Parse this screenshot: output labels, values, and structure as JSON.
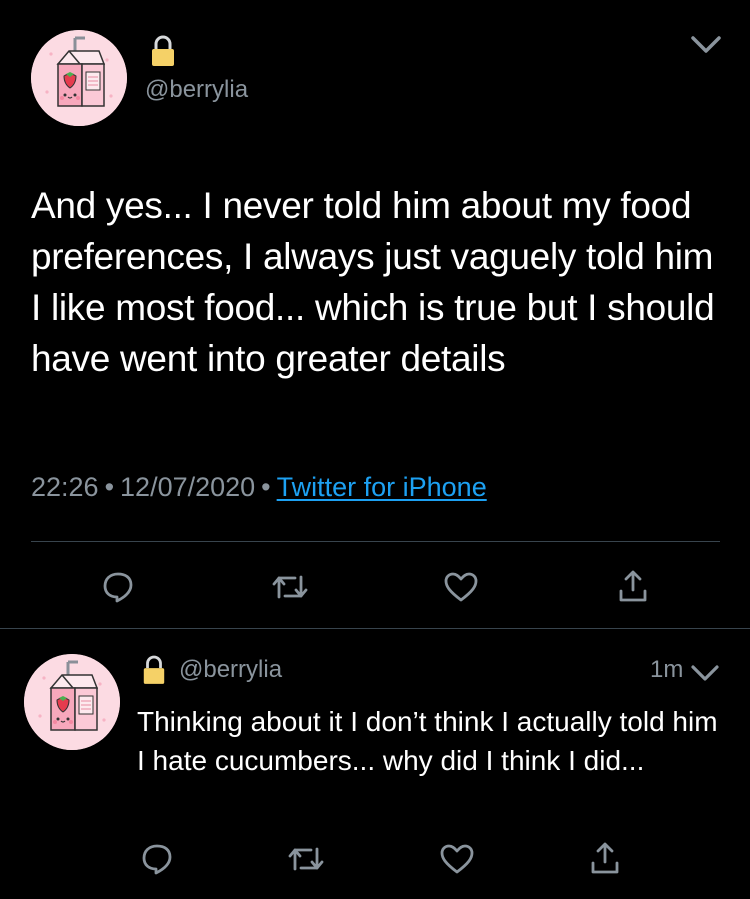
{
  "colors": {
    "background": "#000000",
    "text_primary": "#ffffff",
    "text_secondary": "#8a949d",
    "link": "#1da1f2",
    "divider": "#38444d",
    "lock": "#f5d167",
    "avatar_bg": "#fcdbe3"
  },
  "main_tweet": {
    "avatar_icon": "strawberry-milk-carton-avatar",
    "lock_icon": "lock-icon",
    "handle": "@berrylia",
    "menu_icon": "chevron-down-icon",
    "text": "And yes... I never told him about my food preferences, I always just vaguely told him I like most food... which is true but I should have went into greater details",
    "time": "22:26",
    "date": "12/07/2020",
    "source": "Twitter for iPhone",
    "separator": "•",
    "actions": [
      "reply-icon",
      "retweet-icon",
      "like-icon",
      "share-icon"
    ]
  },
  "reply_tweet": {
    "avatar_icon": "strawberry-milk-carton-avatar",
    "lock_icon": "lock-icon",
    "handle": "@berrylia",
    "time_ago": "1m",
    "menu_icon": "chevron-down-icon",
    "text": "Thinking about it I don’t think I actually told him I hate cucumbers... why did I think I did...",
    "actions": [
      "reply-icon",
      "retweet-icon",
      "like-icon",
      "share-icon"
    ]
  }
}
